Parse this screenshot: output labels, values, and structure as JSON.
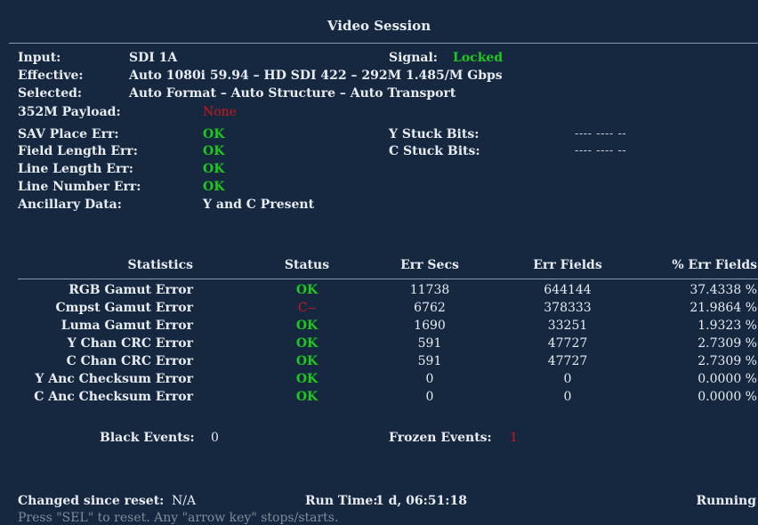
{
  "title": "Video Session",
  "info": {
    "input_label": "Input:",
    "input_value": "SDI 1A",
    "signal_label": "Signal:",
    "signal_value": "Locked",
    "effective_label": "Effective:",
    "effective_value": "Auto 1080i 59.94 – HD SDI 422 – 292M 1.485/M Gbps",
    "selected_label": "Selected:",
    "selected_value": "Auto Format – Auto Structure – Auto Transport",
    "payload_label": "352M Payload:",
    "payload_value": "None"
  },
  "errors": {
    "sav_label": "SAV Place Err:",
    "sav_value": "OK",
    "field_label": "Field Length Err:",
    "field_value": "OK",
    "line_length_label": "Line Length Err:",
    "line_length_value": "OK",
    "line_number_label": "Line Number Err:",
    "line_number_value": "OK",
    "anc_label": "Ancillary Data:",
    "anc_value": "Y and C Present",
    "y_stuck_label": "Y Stuck Bits:",
    "y_stuck_value": "---- ---- --",
    "c_stuck_label": "C Stuck Bits:",
    "c_stuck_value": "---- ---- --"
  },
  "stats": {
    "headers": [
      "Statistics",
      "Status",
      "Err Secs",
      "Err Fields",
      "% Err Fields"
    ],
    "rows": [
      {
        "name": "RGB Gamut Error",
        "status": "OK",
        "secs": "11738",
        "fields": "644144",
        "pct": "37.4338 %"
      },
      {
        "name": "Cmpst Gamut Error",
        "status": "C--",
        "secs": "6762",
        "fields": "378333",
        "pct": "21.9864 %"
      },
      {
        "name": "Luma Gamut Error",
        "status": "OK",
        "secs": "1690",
        "fields": "33251",
        "pct": "1.9323 %"
      },
      {
        "name": "Y Chan CRC Error",
        "status": "OK",
        "secs": "591",
        "fields": "47727",
        "pct": "2.7309 %"
      },
      {
        "name": "C Chan CRC Error",
        "status": "OK",
        "secs": "591",
        "fields": "47727",
        "pct": "2.7309 %"
      },
      {
        "name": "Y Anc Checksum Error",
        "status": "OK",
        "secs": "0",
        "fields": "0",
        "pct": "0.0000 %"
      },
      {
        "name": "C Anc Checksum Error",
        "status": "OK",
        "secs": "0",
        "fields": "0",
        "pct": "0.0000 %"
      }
    ]
  },
  "events": {
    "black_label": "Black Events:",
    "black_value": "0",
    "frozen_label": "Frozen Events:",
    "frozen_value": "1"
  },
  "footer": {
    "changed_label": "Changed since reset:",
    "changed_value": "N/A",
    "runtime_label": "Run Time:",
    "runtime_value": "1 d, 06:51:18",
    "state": "Running",
    "hint": "Press \"SEL\" to reset.  Any \"arrow key\" stops/starts."
  },
  "colors": {
    "background": "#162840",
    "ok": "#1ec81e",
    "error": "#cc1818",
    "text": "#e8ecf2"
  }
}
